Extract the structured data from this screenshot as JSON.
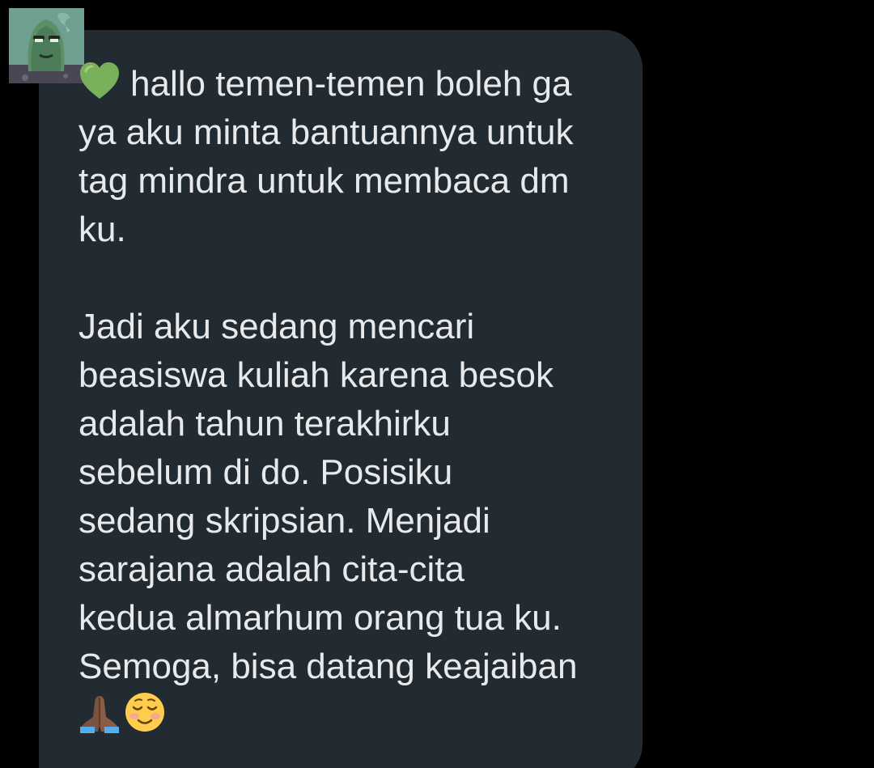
{
  "message": {
    "lines_p1": [
      "hallo temen-temen boleh ga",
      "ya aku minta bantuannya untuk",
      "tag mindra untuk membaca dm",
      "ku."
    ],
    "lines_p2": [
      "Jadi aku sedang mencari",
      "beasiswa kuliah karena besok",
      "adalah tahun terakhirku",
      "sebelum di do. Posisiku",
      "sedang skripsian. Menjadi",
      "sarajana adalah cita-cita",
      "kedua almarhum orang tua ku.",
      "Semoga, bisa datang keajaiban"
    ],
    "leading_emoji": "green-heart-icon",
    "trailing_emojis": [
      "folded-hands-icon",
      "smiling-face-icon"
    ]
  },
  "colors": {
    "background": "#000000",
    "bubble": "#232b32",
    "text": "#e7e9ea"
  }
}
